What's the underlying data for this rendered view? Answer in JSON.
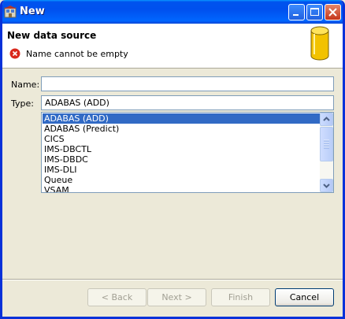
{
  "window": {
    "title": "New"
  },
  "header": {
    "title": "New data source",
    "error_message": "Name cannot be empty"
  },
  "form": {
    "name_label": "Name:",
    "name_value": "",
    "type_label": "Type:",
    "type_value": "ADABAS (ADD)"
  },
  "type_list": {
    "items": [
      "ADABAS (ADD)",
      "ADABAS (Predict)",
      "CICS",
      "IMS-DBCTL",
      "IMS-DBDC",
      "IMS-DLI",
      "Queue",
      "VSAM"
    ],
    "selected_index": 0
  },
  "buttons": {
    "back_label": "< Back",
    "next_label": "Next >",
    "finish_label": "Finish",
    "cancel_label": "Cancel"
  },
  "colors": {
    "selection": "#316ac5",
    "titlebar": "#0053ee",
    "error": "#d9281c"
  }
}
